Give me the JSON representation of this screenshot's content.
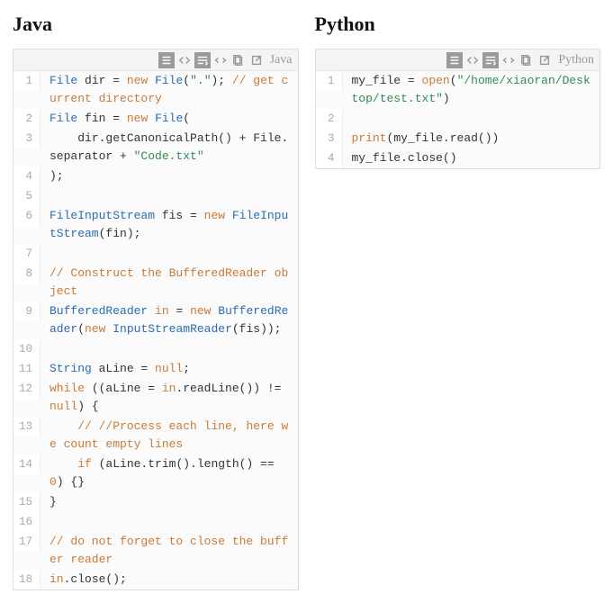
{
  "columns": [
    {
      "title": "Java",
      "toolbar_lang": "Java",
      "lines": [
        {
          "n": 1,
          "tokens": [
            [
              "type",
              "File"
            ],
            [
              "",
              ""
            ],
            [
              "ident",
              " dir "
            ],
            [
              "punc",
              "= "
            ],
            [
              "kw",
              "new"
            ],
            [
              "ident",
              " "
            ],
            [
              "type",
              "File"
            ],
            [
              "punc",
              "("
            ],
            [
              "str",
              "\".\""
            ],
            [
              "punc",
              "); "
            ],
            [
              "cmt",
              "// get current directory"
            ]
          ]
        },
        {
          "n": 2,
          "tokens": [
            [
              "type",
              "File"
            ],
            [
              "ident",
              " fin "
            ],
            [
              "punc",
              "= "
            ],
            [
              "kw",
              "new"
            ],
            [
              "ident",
              " "
            ],
            [
              "type",
              "File"
            ],
            [
              "punc",
              "("
            ]
          ]
        },
        {
          "n": 3,
          "tokens": [
            [
              "ident",
              "    dir.getCanonicalPath() + File.separator + "
            ],
            [
              "str",
              "\"Code.txt\""
            ]
          ]
        },
        {
          "n": 4,
          "tokens": [
            [
              "punc",
              ");"
            ]
          ]
        },
        {
          "n": 5,
          "tokens": [
            [
              "",
              ""
            ]
          ]
        },
        {
          "n": 6,
          "tokens": [
            [
              "type",
              "FileInputStream"
            ],
            [
              "ident",
              " fis "
            ],
            [
              "punc",
              "= "
            ],
            [
              "kw",
              "new"
            ],
            [
              "ident",
              " "
            ],
            [
              "type",
              "FileInputStream"
            ],
            [
              "punc",
              "(fin);"
            ]
          ]
        },
        {
          "n": 7,
          "tokens": [
            [
              "",
              ""
            ]
          ]
        },
        {
          "n": 8,
          "tokens": [
            [
              "cmt",
              "// Construct the BufferedReader object"
            ]
          ]
        },
        {
          "n": 9,
          "tokens": [
            [
              "type",
              "BufferedReader"
            ],
            [
              "ident",
              " "
            ],
            [
              "kw",
              "in"
            ],
            [
              "ident",
              " "
            ],
            [
              "punc",
              "= "
            ],
            [
              "kw",
              "new"
            ],
            [
              "ident",
              " "
            ],
            [
              "type",
              "BufferedReader"
            ],
            [
              "punc",
              "("
            ],
            [
              "kw",
              "new"
            ],
            [
              "ident",
              " "
            ],
            [
              "type",
              "InputStreamReader"
            ],
            [
              "punc",
              "(fis));"
            ]
          ]
        },
        {
          "n": 10,
          "tokens": [
            [
              "",
              ""
            ]
          ]
        },
        {
          "n": 11,
          "tokens": [
            [
              "type",
              "String"
            ],
            [
              "ident",
              " aLine "
            ],
            [
              "punc",
              "= "
            ],
            [
              "kw",
              "null"
            ],
            [
              "punc",
              ";"
            ]
          ]
        },
        {
          "n": 12,
          "tokens": [
            [
              "kw",
              "while"
            ],
            [
              "ident",
              " ((aLine = "
            ],
            [
              "kw",
              "in"
            ],
            [
              "ident",
              ".readLine()) != "
            ],
            [
              "kw",
              "null"
            ],
            [
              "punc",
              ") {"
            ]
          ]
        },
        {
          "n": 13,
          "tokens": [
            [
              "ident",
              "    "
            ],
            [
              "cmt",
              "// //Process each line, here we count empty lines"
            ]
          ]
        },
        {
          "n": 14,
          "tokens": [
            [
              "ident",
              "    "
            ],
            [
              "kw",
              "if"
            ],
            [
              "ident",
              " (aLine.trim().length() == "
            ],
            [
              "num",
              "0"
            ],
            [
              "punc",
              ") {}"
            ]
          ]
        },
        {
          "n": 15,
          "tokens": [
            [
              "punc",
              "}"
            ]
          ]
        },
        {
          "n": 16,
          "tokens": [
            [
              "",
              ""
            ]
          ]
        },
        {
          "n": 17,
          "tokens": [
            [
              "cmt",
              "// do not forget to close the buffer reader"
            ]
          ]
        },
        {
          "n": 18,
          "tokens": [
            [
              "kw",
              "in"
            ],
            [
              "ident",
              ".close();"
            ]
          ]
        }
      ]
    },
    {
      "title": "Python",
      "toolbar_lang": "Python",
      "lines": [
        {
          "n": 1,
          "tokens": [
            [
              "ident",
              "my_file "
            ],
            [
              "punc",
              "= "
            ],
            [
              "func",
              "open"
            ],
            [
              "punc",
              "("
            ],
            [
              "str",
              "\"/home/xiaoran/Desktop/test.txt\""
            ],
            [
              "punc",
              ")"
            ]
          ]
        },
        {
          "n": 2,
          "tokens": [
            [
              "",
              ""
            ]
          ]
        },
        {
          "n": 3,
          "tokens": [
            [
              "func",
              "print"
            ],
            [
              "punc",
              "(my_file.read())"
            ]
          ]
        },
        {
          "n": 4,
          "tokens": [
            [
              "ident",
              "my_file.close()"
            ]
          ]
        }
      ]
    }
  ],
  "toolbar_icons": [
    {
      "name": "lines-icon",
      "glyph": "svg-lines",
      "active": true
    },
    {
      "name": "code-icon",
      "glyph": "svg-code",
      "active": false
    },
    {
      "name": "wrap-icon",
      "glyph": "svg-wrap",
      "active": true
    },
    {
      "name": "expand-icon",
      "glyph": "svg-expand",
      "active": false
    },
    {
      "name": "copy-icon",
      "glyph": "svg-copy",
      "active": false
    },
    {
      "n": "open-icon",
      "name": "open-icon",
      "glyph": "svg-open",
      "active": false
    }
  ]
}
